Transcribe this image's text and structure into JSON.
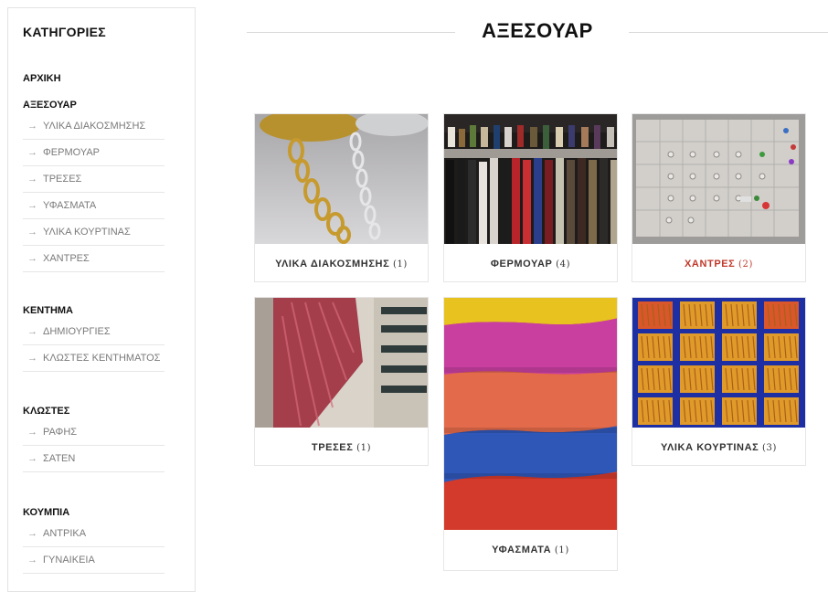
{
  "sidebar": {
    "title": "ΚΑΤΗΓΟΡΙΕΣ",
    "home": "ΑΡΧΙΚΗ",
    "groups": [
      {
        "heading": "ΑΞΕΣΟΥΑΡ",
        "items": [
          "ΥΛΙΚΑ ΔΙΑΚΟΣΜΗΣΗΣ",
          "ΦΕΡΜΟΥΑΡ",
          "ΤΡΕΣΕΣ",
          "ΥΦΑΣΜΑΤΑ",
          "ΥΛΙΚΑ ΚΟΥΡΤΙΝΑΣ",
          "ΧΑΝΤΡΕΣ"
        ]
      },
      {
        "heading": "ΚΕΝΤΗΜΑ",
        "items": [
          "ΔΗΜΙΟΥΡΓΙΕΣ",
          "ΚΛΩΣΤΕΣ ΚΕΝΤΗΜΑΤΟΣ"
        ]
      },
      {
        "heading": "ΚΛΩΣΤΕΣ",
        "items": [
          "ΡΑΦΗΣ",
          "ΣΑΤΕΝ"
        ]
      },
      {
        "heading": "ΚΟΥΜΠΙΑ",
        "items": [
          "ΑΝΤΡΙΚΑ",
          "ΓΥΝΑΙΚΕΙΑ"
        ]
      }
    ],
    "arrow": "→"
  },
  "main": {
    "title": "ΑΞΕΣΟΥΑΡ",
    "cards": [
      {
        "name": "ΥΛΙΚΑ ΔΙΑΚΟΣΜΗΣΗΣ",
        "count": "(1)"
      },
      {
        "name": "ΦΕΡΜΟΥΑΡ",
        "count": "(4)"
      },
      {
        "name": "ΧΑΝΤΡΕΣ",
        "count": "(2)"
      },
      {
        "name": "ΤΡΕΣΕΣ",
        "count": "(1)"
      },
      {
        "name": "ΥΦΑΣΜΑΤΑ",
        "count": "(1)"
      },
      {
        "name": "ΥΛΙΚΑ ΚΟΥΡΤΙΝΑΣ",
        "count": "(3)"
      }
    ]
  },
  "colors": {
    "active_label": "#c0392b",
    "border": "#e6e6e6",
    "muted_text": "#7a7a7a"
  }
}
